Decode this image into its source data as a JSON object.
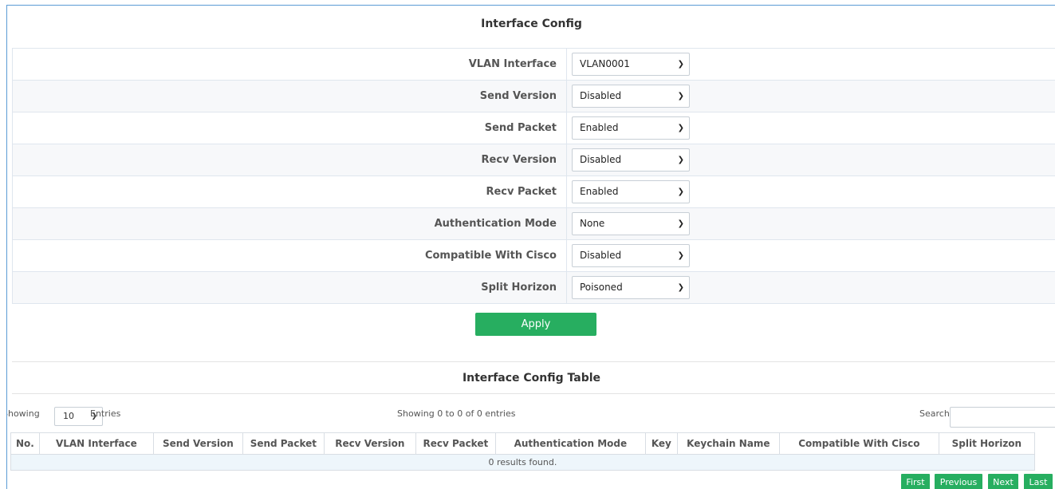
{
  "page_title": "Interface Config",
  "form": {
    "rows": [
      {
        "label": "VLAN Interface",
        "value": "VLAN0001"
      },
      {
        "label": "Send Version",
        "value": "Disabled"
      },
      {
        "label": "Send Packet",
        "value": "Enabled"
      },
      {
        "label": "Recv Version",
        "value": "Disabled"
      },
      {
        "label": "Recv Packet",
        "value": "Enabled"
      },
      {
        "label": "Authentication Mode",
        "value": "None"
      },
      {
        "label": "Compatible With Cisco",
        "value": "Disabled"
      },
      {
        "label": "Split Horizon",
        "value": "Poisoned"
      }
    ],
    "apply_label": "Apply"
  },
  "table_section": {
    "title": "Interface Config Table",
    "showing_label": "Showing",
    "page_size": "10",
    "entries_label": "Entries",
    "info": "Showing 0 to 0 of 0 entries",
    "search_label": "Search",
    "search_value": "",
    "columns": [
      "No.",
      "VLAN Interface",
      "Send Version",
      "Send Packet",
      "Recv Version",
      "Recv Packet",
      "Authentication Mode",
      "Key",
      "Keychain Name",
      "Compatible With Cisco",
      "Split Horizon"
    ],
    "empty_message": "0 results found."
  },
  "pager": {
    "first": "First",
    "previous": "Previous",
    "next": "Next",
    "last": "Last"
  },
  "colors": {
    "accent_green": "#27ae60",
    "frame_blue": "#5b9bd5",
    "empty_row_bg": "#eef6fb"
  }
}
